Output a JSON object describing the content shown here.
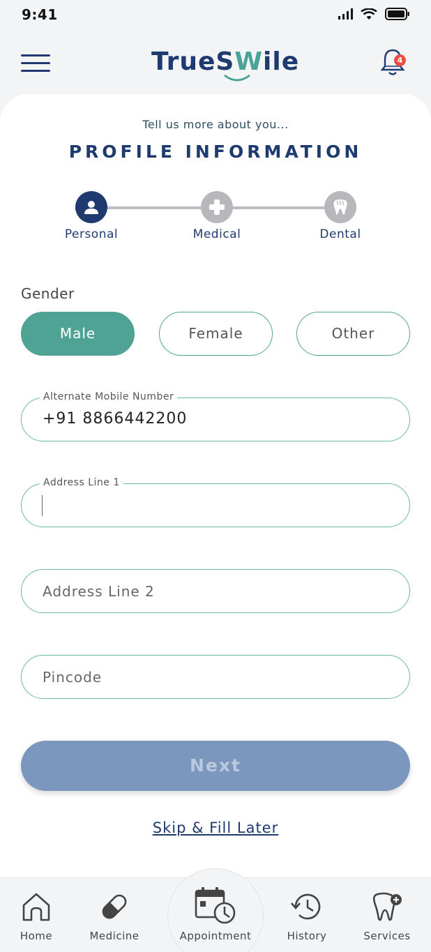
{
  "status_bar": {
    "time": "9:41"
  },
  "header": {
    "logo_part1": "TrueS",
    "logo_part2": "W",
    "logo_part3": "ile",
    "notification_count": "4"
  },
  "page": {
    "subtitle": "Tell us more about you...",
    "title": "PROFILE INFORMATION"
  },
  "stepper": {
    "steps": [
      {
        "label": "Personal",
        "state": "active"
      },
      {
        "label": "Medical",
        "state": "inactive"
      },
      {
        "label": "Dental",
        "state": "inactive"
      }
    ]
  },
  "gender": {
    "label": "Gender",
    "options": [
      "Male",
      "Female",
      "Other"
    ],
    "selected": "Male"
  },
  "form": {
    "alt_mobile_label": "Alternate Mobile Number",
    "alt_mobile_value": "+91 8866442200",
    "address1_label": "Address Line 1",
    "address1_value": "",
    "address2_placeholder": "Address Line 2",
    "pincode_placeholder": "Pincode"
  },
  "actions": {
    "next_label": "Next",
    "skip_label": "Skip & Fill Later"
  },
  "bottom_nav": {
    "items": [
      {
        "label": "Home",
        "icon": "home-icon"
      },
      {
        "label": "Medicine",
        "icon": "pill-icon"
      },
      {
        "label": "Appointment",
        "icon": "calendar-clock-icon"
      },
      {
        "label": "History",
        "icon": "history-icon"
      },
      {
        "label": "Services",
        "icon": "tooth-plus-icon"
      }
    ]
  },
  "colors": {
    "primary": "#1e3a6e",
    "accent": "#4fa394",
    "next_disabled": "#7b97be",
    "badge": "#e94e43"
  }
}
